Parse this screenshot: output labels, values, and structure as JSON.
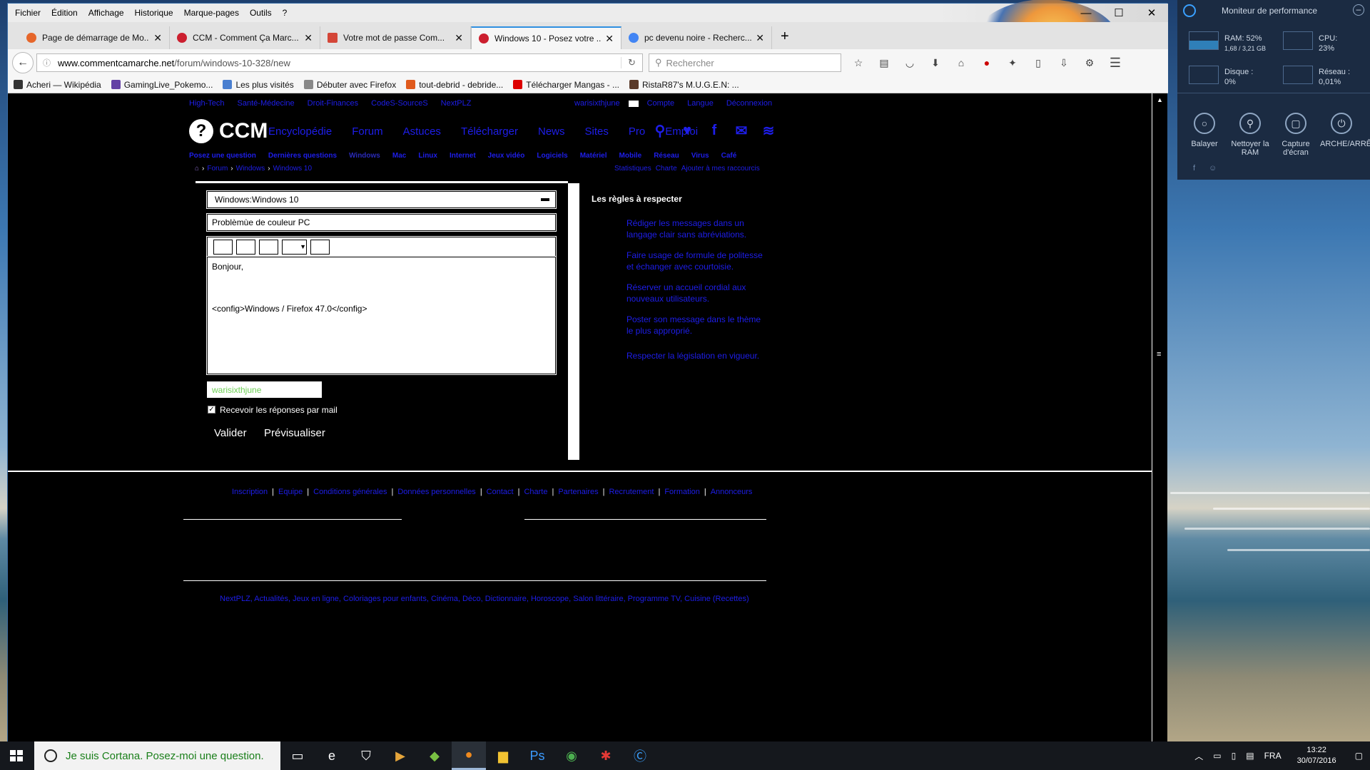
{
  "menubar": {
    "items": [
      "Fichier",
      "Édition",
      "Affichage",
      "Historique",
      "Marque-pages",
      "Outils",
      "?"
    ]
  },
  "tabs": [
    {
      "title": "Page de démarrage de Mo...",
      "icon": "firefox-icon",
      "color": "#e6662a"
    },
    {
      "title": "CCM - Comment Ça Marc...",
      "icon": "ccm-icon",
      "color": "#cc1f2f"
    },
    {
      "title": "Votre mot de passe Com...",
      "icon": "gmail-icon",
      "color": "#d44638"
    },
    {
      "title": "Windows 10 - Posez votre ...",
      "icon": "ccm-icon",
      "color": "#cc1f2f",
      "active": true
    },
    {
      "title": "pc devenu noire - Recherc...",
      "icon": "google-icon",
      "color": "#4285f4"
    }
  ],
  "nav": {
    "url_domain": "www.commentcamarche.net",
    "url_path": "/forum/windows-10-328/new",
    "search_placeholder": "Rechercher"
  },
  "bookmarks": [
    "Acheri — Wikipédia",
    "GamingLive_Pokemo...",
    "Les plus visités",
    "Débuter avec Firefox",
    "tout-debrid - debride...",
    "Télécharger Mangas - ...",
    "RistaR87's M.U.G.E.N: ..."
  ],
  "site": {
    "top_links": [
      "High-Tech",
      "Santé-Médecine",
      "Droit-Finances",
      "CodeS-SourceS",
      "NextPLZ"
    ],
    "user": "warisixthjune",
    "account_links": [
      "Compte",
      "Langue",
      "Déconnexion"
    ],
    "logo_text": "CCM",
    "main_nav": [
      "Encyclopédie",
      "Forum",
      "Astuces",
      "Télécharger",
      "News",
      "Sites",
      "Pro",
      "Emploi"
    ],
    "sub_nav": [
      "Posez une question",
      "Dernières questions",
      "Windows",
      "Mac",
      "Linux",
      "Internet",
      "Jeux vidéo",
      "Logiciels",
      "Matériel",
      "Mobile",
      "Réseau",
      "Virus",
      "Café"
    ],
    "breadcrumb": [
      "Forum",
      "Windows",
      "Windows 10"
    ],
    "crumb_links": [
      "Statistiques",
      "Charte",
      "Ajouter à mes raccourcis"
    ]
  },
  "form": {
    "category": "Windows:Windows 10",
    "subject": "Problèmùe de couleur PC",
    "body_line1": "Bonjour,",
    "body_line2": "<config>Windows / Firefox 47.0</config>",
    "username": "warisixthjune",
    "notify_label": "Recevoir les réponses par mail",
    "notify_checked": true,
    "submit_label": "Valider",
    "preview_label": "Prévisualiser"
  },
  "rules": {
    "title": "Les règles à respecter",
    "items": [
      "Rédiger les messages dans un langage clair sans abréviations.",
      "Faire usage de formule de politesse et échanger avec courtoisie.",
      "Réserver un accueil cordial aux nouveaux utilisateurs.",
      "Poster son message dans le thème le plus approprié.",
      "Respecter la législation en vigueur."
    ]
  },
  "footer": {
    "links": [
      "Inscription",
      "Equipe",
      "Conditions générales",
      "Données personnelles",
      "Contact",
      "Charte",
      "Partenaires",
      "Recrutement",
      "Formation",
      "Annonceurs"
    ],
    "bottom_links": "NextPLZ, Actualités, Jeux en ligne, Coloriages pour enfants, Cinéma, Déco, Dictionnaire, Horoscope, Salon littéraire, Programme TV, Cuisine (Recettes)"
  },
  "perf_monitor": {
    "title": "Moniteur de performance",
    "ram": "RAM: 52%",
    "ram_detail": "1,68 / 3,21 GB",
    "cpu": "CPU:",
    "cpu_value": "23%",
    "disk": "Disque :",
    "disk_value": "0%",
    "net": "Réseau :",
    "net_value": "0,01%",
    "tools": [
      "Balayer",
      "Nettoyer la RAM",
      "Capture d'écran",
      "ARCHE/ARRÊ"
    ]
  },
  "taskbar": {
    "cortana_text": "Je suis Cortana. Posez-moi une question.",
    "lang": "FRA",
    "time": "13:22",
    "date": "30/07/2016"
  }
}
